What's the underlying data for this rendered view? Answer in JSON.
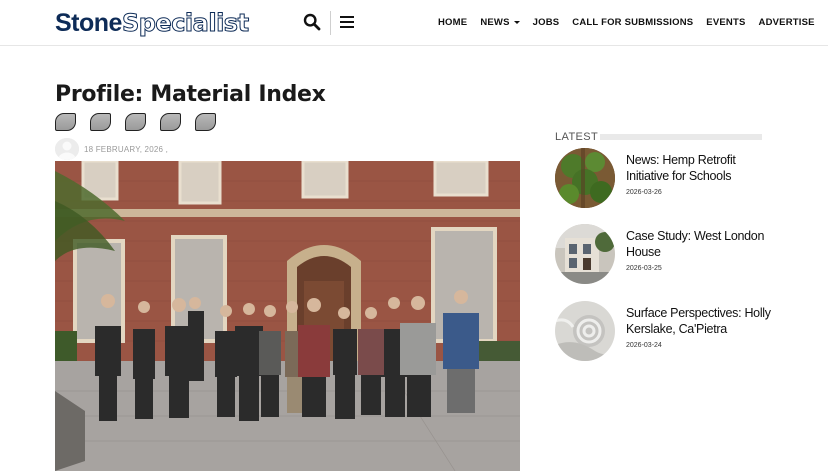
{
  "header": {
    "logo": {
      "part1": "Stone",
      "part2": "Specialist"
    },
    "nav": [
      {
        "label": "HOME"
      },
      {
        "label": "NEWS"
      },
      {
        "label": "JOBS"
      },
      {
        "label": "CALL FOR SUBMISSIONS"
      },
      {
        "label": "EVENTS"
      },
      {
        "label": "ADVERTISE"
      }
    ],
    "icons": {
      "search": "search-icon",
      "menu": "hamburger-menu-icon",
      "news_dropdown": "caret-down-icon"
    }
  },
  "article": {
    "title": "Profile: Material Index",
    "share_buttons": [
      "share-button",
      "share-button",
      "share-button",
      "share-button",
      "share-button"
    ],
    "date": "18 FEBRUARY, 2026 ,"
  },
  "sidebar": {
    "heading": "LATEST",
    "posts": [
      {
        "title": "News: Hemp Retrofit Initiative for Schools",
        "date": "2026-03-26"
      },
      {
        "title": "Case Study: West London House",
        "date": "2026-03-25"
      },
      {
        "title": "Surface Perspectives: Holly Kerslake, Ca'Pietra",
        "date": "2026-03-24"
      }
    ]
  },
  "colors": {
    "brand": "#0d2b57",
    "text": "#111111",
    "muted": "#9a9a9a"
  }
}
